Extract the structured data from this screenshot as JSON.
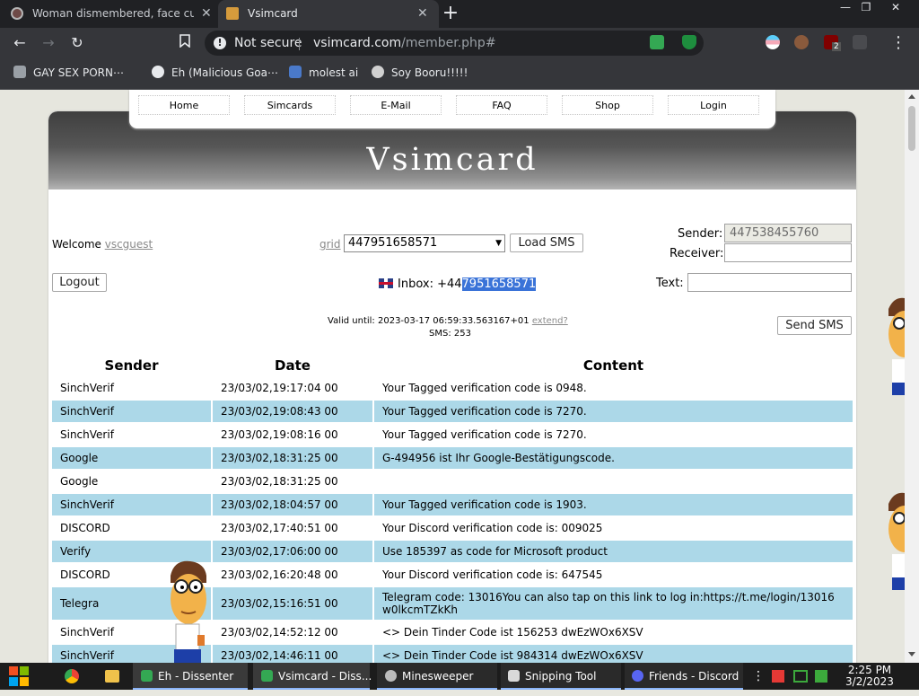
{
  "browser": {
    "tabs": [
      {
        "title": "Woman dismembered, face cut in",
        "close": "✕"
      },
      {
        "title": "Vsimcard",
        "close": "✕"
      }
    ],
    "new_tab": "+",
    "window_controls": {
      "minimize": "—",
      "restore": "❐",
      "close": "✕"
    },
    "nav": {
      "back": "←",
      "forward": "→",
      "reload": "↻",
      "bookmark": "⚲"
    },
    "omnibox": {
      "security": "Not secure",
      "host": "vsimcard.com",
      "path": "/member.php#"
    },
    "menu": "⋮",
    "bookmarks": [
      {
        "label": "GAY SEX PORN⋯"
      },
      {
        "label": "Eh (Malicious Goa⋯"
      },
      {
        "label": "molest ai"
      },
      {
        "label": "Soy Booru!!!!!"
      }
    ],
    "extension_badge": "2"
  },
  "site": {
    "nav": [
      "Home",
      "Simcards",
      "E-Mail",
      "FAQ",
      "Shop",
      "Login"
    ],
    "title": "Vsimcard",
    "welcome_label": "Welcome",
    "username": "vscguest",
    "grid_link": "grid",
    "number_select": "447951658571",
    "load_button": "Load SMS",
    "logout_button": "Logout",
    "inbox_prefix": "Inbox: +44",
    "inbox_number_selected": "7951658571",
    "valid_until": "Valid until: 2023-03-17 06:59:33.563167+01",
    "extend_link": "extend?",
    "sms_count": "SMS: 253",
    "sender_label": "Sender:",
    "sender_value": "447538455760",
    "receiver_label": "Receiver:",
    "receiver_value": "",
    "text_label": "Text:",
    "text_value": "",
    "send_button": "Send SMS",
    "columns": [
      "Sender",
      "Date",
      "Content"
    ],
    "rows": [
      {
        "sender": "SinchVerif",
        "date": "23/03/02,19:17:04 00",
        "content": "Your Tagged verification code is 0948."
      },
      {
        "sender": "SinchVerif",
        "date": "23/03/02,19:08:43 00",
        "content": "Your Tagged verification code is 7270."
      },
      {
        "sender": "SinchVerif",
        "date": "23/03/02,19:08:16 00",
        "content": "Your Tagged verification code is 7270."
      },
      {
        "sender": "Google",
        "date": "23/03/02,18:31:25 00",
        "content": "G-494956 ist Ihr Google-Bestätigungscode."
      },
      {
        "sender": "Google",
        "date": "23/03/02,18:31:25 00",
        "content": ""
      },
      {
        "sender": "SinchVerif",
        "date": "23/03/02,18:04:57 00",
        "content": "Your Tagged verification code is 1903."
      },
      {
        "sender": "DISCORD",
        "date": "23/03/02,17:40:51 00",
        "content": "Your Discord verification code is: 009025"
      },
      {
        "sender": "Verify",
        "date": "23/03/02,17:06:00 00",
        "content": "Use 185397 as code for Microsoft product"
      },
      {
        "sender": "DISCORD",
        "date": "23/03/02,16:20:48 00",
        "content": "Your Discord verification code is: 647545"
      },
      {
        "sender": "Telegra",
        "date": "23/03/02,15:16:51 00",
        "content": "Telegram code: 13016You can also tap on this link to log in:https://t.me/login/13016 w0lkcmTZkKh"
      },
      {
        "sender": "SinchVerif",
        "date": "23/03/02,14:52:12 00",
        "content": "<> Dein Tinder Code ist 156253 dwEzWOx6XSV"
      },
      {
        "sender": "SinchVerif",
        "date": "23/03/02,14:46:11 00",
        "content": "<> Dein Tinder Code ist 984314 dwEzWOx6XSV"
      }
    ]
  },
  "taskbar": {
    "items": [
      {
        "label": "Eh - Dissenter"
      },
      {
        "label": "Vsimcard - Diss..."
      },
      {
        "label": "Minesweeper"
      },
      {
        "label": "Snipping Tool"
      },
      {
        "label": "Friends - Discord"
      }
    ],
    "time": "2:25 PM",
    "date": "3/2/2023"
  },
  "colors": {
    "row_alt": "#acd8e8",
    "selection": "#3a73d8",
    "chrome_dark": "#202124"
  }
}
